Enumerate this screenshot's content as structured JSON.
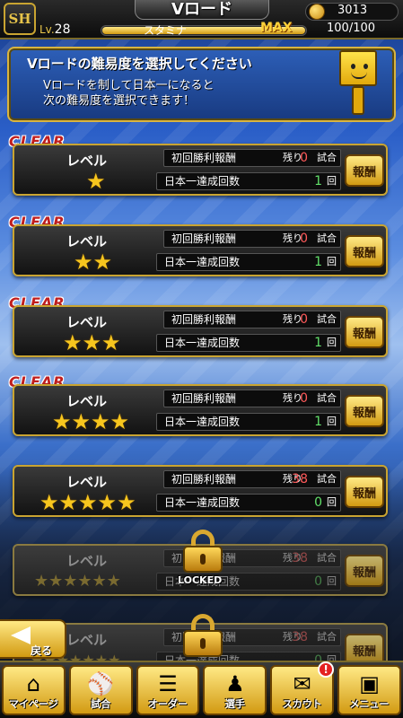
{
  "header": {
    "logo": "SH",
    "title": "Vロード",
    "level_prefix": "Lv.",
    "level": "28",
    "stamina_label": "スタミナ",
    "stamina_max": "MAX",
    "stamina_value": "100/100",
    "stamina_fraction": 1.0,
    "coins": "3013"
  },
  "panel": {
    "heading": "Vロードの難易度を選択してください",
    "line1": "Vロードを制して日本一になると",
    "line2": "次の難易度を選択できます！"
  },
  "labels": {
    "clear": "CLEAR",
    "level": "レベル",
    "first_win_reward": "初回勝利報酬",
    "remaining": "残り",
    "games_unit": "試合",
    "champion_count": "日本一達成回数",
    "times_unit": "回",
    "reward_button": "報酬",
    "locked": "LOCKED"
  },
  "levels": [
    {
      "stars": "★",
      "cleared": true,
      "remaining": "0",
      "count": "1",
      "locked": false
    },
    {
      "stars": "★★",
      "cleared": true,
      "remaining": "0",
      "count": "1",
      "locked": false
    },
    {
      "stars": "★★★",
      "cleared": true,
      "remaining": "0",
      "count": "1",
      "locked": false
    },
    {
      "stars": "★★★★",
      "cleared": true,
      "remaining": "0",
      "count": "1",
      "locked": false
    },
    {
      "stars": "★★★★★",
      "cleared": false,
      "remaining": "38",
      "count": "0",
      "locked": false
    },
    {
      "stars": "★★★★★★",
      "cleared": false,
      "remaining": "38",
      "count": "0",
      "locked": true
    },
    {
      "stars": "★★★★★★★",
      "cleared": false,
      "remaining": "38",
      "count": "0",
      "locked": true
    }
  ],
  "back": {
    "label": "戻る"
  },
  "nav": [
    {
      "label": "マイページ",
      "icon": "home-icon"
    },
    {
      "label": "試合",
      "icon": "match-icon"
    },
    {
      "label": "オーダー",
      "icon": "order-icon"
    },
    {
      "label": "選手",
      "icon": "player-icon"
    },
    {
      "label": "スカウト",
      "icon": "scout-icon",
      "badge": "!"
    },
    {
      "label": "メニュー",
      "icon": "menu-icon"
    }
  ],
  "colors": {
    "gold": "#d9b440",
    "red_count": "#ff5a5a",
    "green_count": "#62e06a",
    "clear_red": "#c11f1f"
  }
}
